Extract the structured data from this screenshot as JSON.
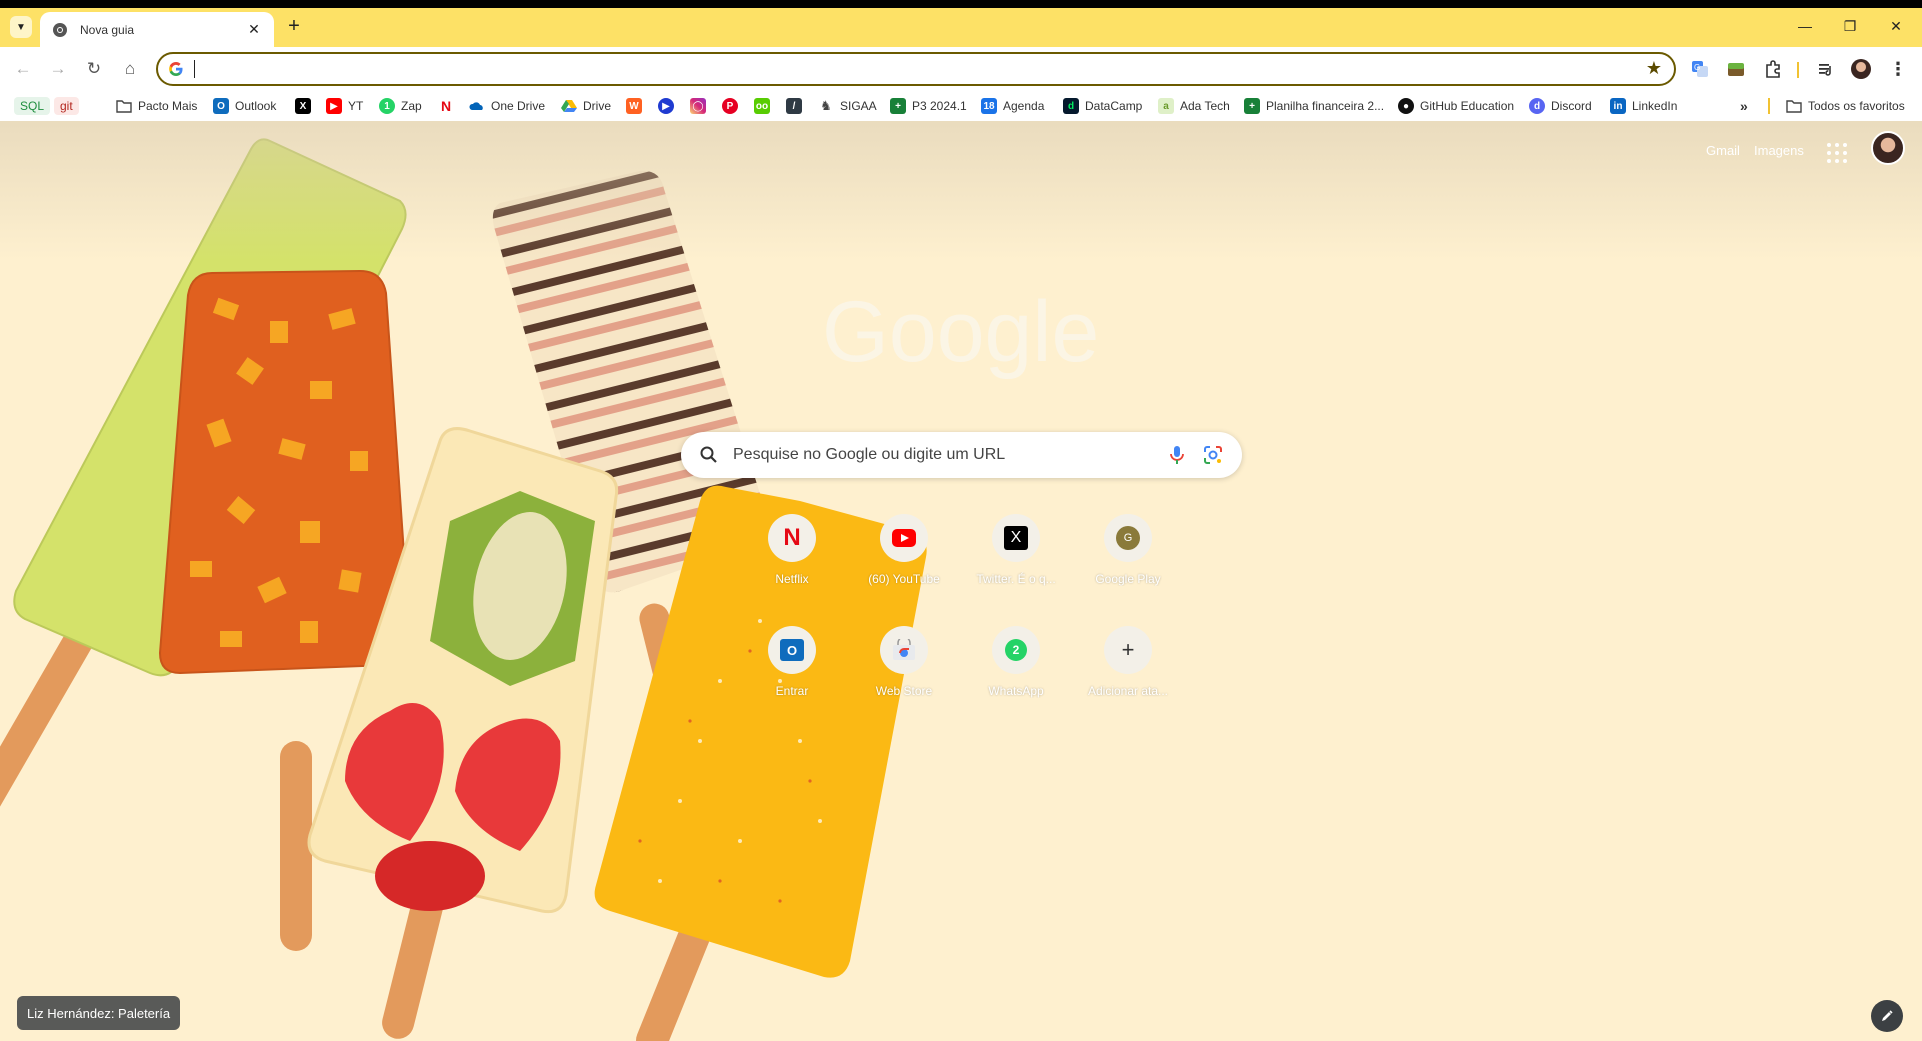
{
  "tab": {
    "title": "Nova guia"
  },
  "omnibox": {
    "value": ""
  },
  "bookmarks": [
    {
      "label": "SQL",
      "kind": "chip",
      "color": "#1e8e3e",
      "bg": "#e6f4ea"
    },
    {
      "label": "git",
      "kind": "chip",
      "color": "#b3261e",
      "bg": "#fce8e6"
    },
    {
      "label": "Pacto Mais",
      "icon": "folder-icon"
    },
    {
      "label": "Outlook",
      "icon": "outlook-icon",
      "color": "#0f6cbd"
    },
    {
      "label": "",
      "icon": "x-icon",
      "color": "#000000"
    },
    {
      "label": "YT",
      "icon": "youtube-icon",
      "color": "#ff0000"
    },
    {
      "label": "Zap",
      "icon": "whatsapp-icon",
      "color": "#25d366"
    },
    {
      "label": "",
      "icon": "netflix-icon",
      "color": "#e50914"
    },
    {
      "label": "One Drive",
      "icon": "onedrive-icon",
      "color": "#0364b8"
    },
    {
      "label": "Drive",
      "icon": "drive-icon",
      "color": "#fbbc04"
    },
    {
      "label": "",
      "icon": "wattpad-icon",
      "color": "#ff6122"
    },
    {
      "label": "",
      "icon": "primevideo-icon",
      "color": "#1f3bd1"
    },
    {
      "label": "",
      "icon": "instagram-icon",
      "color": "#e1306c"
    },
    {
      "label": "",
      "icon": "pinterest-icon",
      "color": "#e60023"
    },
    {
      "label": "",
      "icon": "duolingo-icon",
      "color": "#58cc02"
    },
    {
      "label": "",
      "icon": "notion-icon",
      "color": "#2f3a44"
    },
    {
      "label": "SIGAA",
      "icon": "sigaa-icon",
      "color": "#444444"
    },
    {
      "label": "P3 2024.1",
      "icon": "sheets-icon",
      "color": "#188038"
    },
    {
      "label": "Agenda",
      "icon": "calendar-icon",
      "color": "#1a73e8"
    },
    {
      "label": "DataCamp",
      "icon": "datacamp-icon",
      "color": "#03ef62"
    },
    {
      "label": "Ada Tech",
      "icon": "adatech-icon",
      "color": "#a6d96a"
    },
    {
      "label": "Planilha financeira 2...",
      "icon": "sheets-icon",
      "color": "#188038"
    },
    {
      "label": "GitHub Education",
      "icon": "github-icon",
      "color": "#111111"
    },
    {
      "label": "Discord",
      "icon": "discord-icon",
      "color": "#5865f2"
    },
    {
      "label": "LinkedIn",
      "icon": "linkedin-icon",
      "color": "#0a66c2"
    }
  ],
  "all_bookmarks_label": "Todos os favoritos",
  "ntp": {
    "gmail": "Gmail",
    "images": "Imagens",
    "search_placeholder": "Pesquise no Google ou digite um URL",
    "tiles": [
      {
        "label": "Netflix",
        "icon": "netflix-icon",
        "color": "#e50914"
      },
      {
        "label": "(60) YouTube",
        "icon": "youtube-icon",
        "color": "#ff0000"
      },
      {
        "label": "Twitter. É o q...",
        "icon": "x-icon",
        "color": "#000000"
      },
      {
        "label": "Google Play",
        "icon": "google-play-icon",
        "color": "#8a7a3a"
      },
      {
        "label": "Entrar",
        "icon": "outlook-icon",
        "color": "#0f6cbd"
      },
      {
        "label": "Web Store",
        "icon": "webstore-icon",
        "color": "#4285f4"
      },
      {
        "label": "WhatsApp",
        "icon": "whatsapp-icon",
        "color": "#25d366"
      },
      {
        "label": "Adicionar ata...",
        "icon": "plus-icon",
        "color": "#333333"
      }
    ],
    "attribution": "Liz Hernández: Paletería"
  },
  "colors": {
    "tabstrip": "#fde166",
    "ntp_bg": "#fef0cf",
    "accent": "#6b5a00"
  }
}
